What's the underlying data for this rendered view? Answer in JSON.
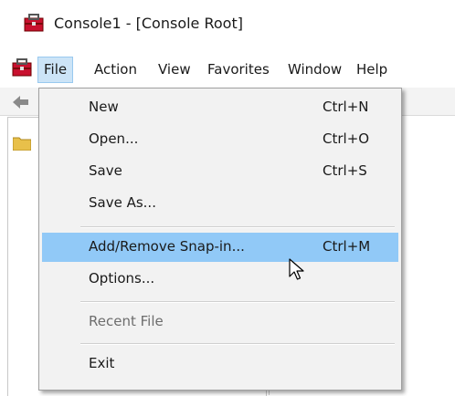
{
  "window": {
    "title": "Console1 - [Console Root]",
    "icon": "mmc-toolbox-icon"
  },
  "menubar": {
    "items": [
      {
        "label": "File",
        "active": true
      },
      {
        "label": "Action"
      },
      {
        "label": "View"
      },
      {
        "label": "Favorites"
      },
      {
        "label": "Window"
      },
      {
        "label": "Help"
      }
    ]
  },
  "toolbar": {
    "back_icon": "back-arrow-icon"
  },
  "tree": {
    "root_icon": "folder-icon"
  },
  "file_menu": {
    "items": [
      {
        "label": "New",
        "shortcut": "Ctrl+N"
      },
      {
        "label": "Open...",
        "shortcut": "Ctrl+O"
      },
      {
        "label": "Save",
        "shortcut": "Ctrl+S"
      },
      {
        "label": "Save As...",
        "shortcut": ""
      },
      {
        "label": "Add/Remove Snap-in...",
        "shortcut": "Ctrl+M",
        "highlighted": true
      },
      {
        "label": "Options...",
        "shortcut": ""
      },
      {
        "label": "Recent File",
        "shortcut": "",
        "disabled": true
      },
      {
        "label": "Exit",
        "shortcut": ""
      }
    ]
  },
  "colors": {
    "menu_background": "#f2f2f2",
    "highlight": "#91c9f7",
    "active_menu": "#cce4f7",
    "disabled_text": "#6d6d6d",
    "icon_red": "#c8102e"
  }
}
